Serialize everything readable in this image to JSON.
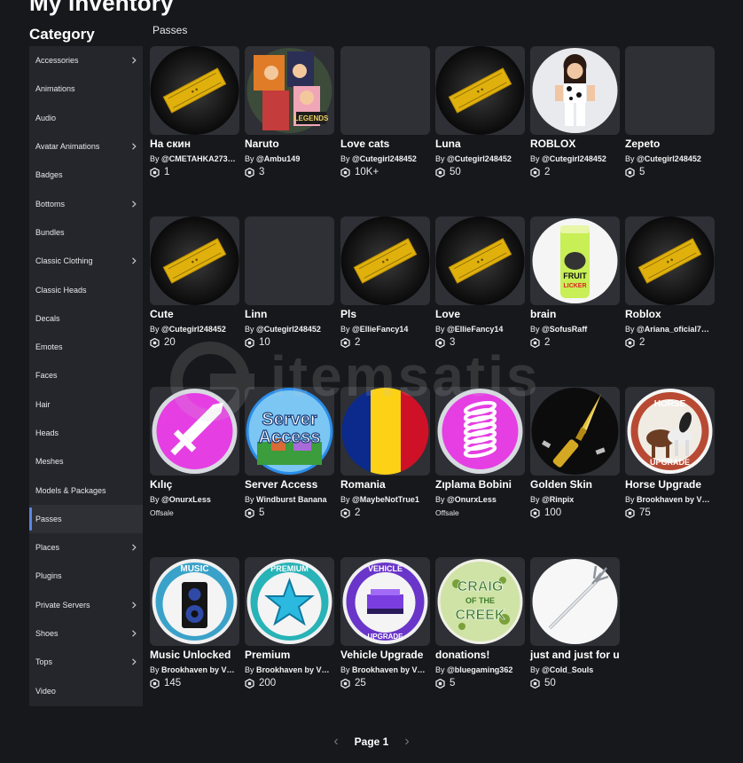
{
  "page": {
    "title": "My Inventory",
    "category_heading": "Category",
    "section_label": "Passes"
  },
  "sidebar": {
    "items": [
      {
        "label": "Accessories",
        "chevron": true
      },
      {
        "label": "Animations",
        "chevron": false
      },
      {
        "label": "Audio",
        "chevron": false
      },
      {
        "label": "Avatar Animations",
        "chevron": true
      },
      {
        "label": "Badges",
        "chevron": false
      },
      {
        "label": "Bottoms",
        "chevron": true
      },
      {
        "label": "Bundles",
        "chevron": false
      },
      {
        "label": "Classic Clothing",
        "chevron": true
      },
      {
        "label": "Classic Heads",
        "chevron": false
      },
      {
        "label": "Decals",
        "chevron": false
      },
      {
        "label": "Emotes",
        "chevron": false
      },
      {
        "label": "Faces",
        "chevron": false
      },
      {
        "label": "Hair",
        "chevron": false
      },
      {
        "label": "Heads",
        "chevron": false
      },
      {
        "label": "Meshes",
        "chevron": false
      },
      {
        "label": "Models & Packages",
        "chevron": false
      },
      {
        "label": "Passes",
        "chevron": false,
        "active": true
      },
      {
        "label": "Places",
        "chevron": true
      },
      {
        "label": "Plugins",
        "chevron": false
      },
      {
        "label": "Private Servers",
        "chevron": true
      },
      {
        "label": "Shoes",
        "chevron": true
      },
      {
        "label": "Tops",
        "chevron": true
      },
      {
        "label": "Video",
        "chevron": false
      }
    ]
  },
  "items": [
    {
      "name": "На скин",
      "by": "By",
      "creator": "@CMETAHKA273…",
      "price": "1",
      "thumb": "ticket"
    },
    {
      "name": "Naruto",
      "by": "By",
      "creator": "@Ambu149",
      "price": "3",
      "thumb": "naruto"
    },
    {
      "name": "Love cats",
      "by": "By",
      "creator": "@Cutegirl248452",
      "price": "10K+",
      "thumb": "blank"
    },
    {
      "name": "Luna",
      "by": "By",
      "creator": "@Cutegirl248452",
      "price": "50",
      "thumb": "ticket"
    },
    {
      "name": "ROBLOX",
      "by": "By",
      "creator": "@Cutegirl248452",
      "price": "2",
      "thumb": "avatar"
    },
    {
      "name": "Zepeto",
      "by": "By",
      "creator": "@Cutegirl248452",
      "price": "5",
      "thumb": "blank"
    },
    {
      "name": "Cute",
      "by": "By",
      "creator": "@Cutegirl248452",
      "price": "20",
      "thumb": "ticket"
    },
    {
      "name": "Linn",
      "by": "By",
      "creator": "@Cutegirl248452",
      "price": "10",
      "thumb": "blank"
    },
    {
      "name": "Pls",
      "by": "By",
      "creator": "@EllieFancy14",
      "price": "2",
      "thumb": "ticket"
    },
    {
      "name": "Love",
      "by": "By",
      "creator": "@EllieFancy14",
      "price": "3",
      "thumb": "ticket"
    },
    {
      "name": "brain",
      "by": "By",
      "creator": "@SofusRaff",
      "price": "2",
      "thumb": "can"
    },
    {
      "name": "Roblox",
      "by": "By",
      "creator": "@Ariana_oficial7…",
      "price": "2",
      "thumb": "ticket"
    },
    {
      "name": "Kılıç",
      "by": "By",
      "creator": "@OnurxLess",
      "price": "",
      "offsale": "Offsale",
      "thumb": "sword"
    },
    {
      "name": "Server Access",
      "by": "By",
      "creator": "Windburst Banana",
      "price": "5",
      "thumb": "server"
    },
    {
      "name": "Romania",
      "by": "By",
      "creator": "@MaybeNotTrue1",
      "price": "2",
      "thumb": "flag"
    },
    {
      "name": "Zıplama Bobini",
      "by": "By",
      "creator": "@OnurxLess",
      "price": "",
      "offsale": "Offsale",
      "thumb": "spring"
    },
    {
      "name": "Golden Skin",
      "by": "By",
      "creator": "@Rinpix",
      "price": "100",
      "thumb": "knife"
    },
    {
      "name": "Horse Upgrade",
      "by": "By",
      "creator": "Brookhaven by V…",
      "price": "75",
      "thumb": "horse"
    },
    {
      "name": "Music Unlocked",
      "by": "By",
      "creator": "Brookhaven by V…",
      "price": "145",
      "thumb": "music",
      "badge_text": "MUSIC"
    },
    {
      "name": "Premium",
      "by": "By",
      "creator": "Brookhaven by V…",
      "price": "200",
      "thumb": "premium",
      "badge_text": "PREMIUM"
    },
    {
      "name": "Vehicle Upgrade",
      "by": "By",
      "creator": "Brookhaven by V…",
      "price": "25",
      "thumb": "vehicle",
      "badge_text": "VEHICLE",
      "badge_text2": "UPGRADE"
    },
    {
      "name": "donations!",
      "by": "By",
      "creator": "@bluegaming362",
      "price": "5",
      "thumb": "craig"
    },
    {
      "name": "just and just for u",
      "by": "By",
      "creator": "@Cold_Souls",
      "price": "50",
      "thumb": "staff"
    }
  ],
  "thumb_texts": {
    "server": [
      "Server",
      "Access"
    ],
    "horse": [
      "HORSE",
      "UPGRADE"
    ],
    "craig": [
      "CRAIG",
      "OF THE",
      "CREEK"
    ],
    "can": [
      "FRUIT",
      "LICKER"
    ]
  },
  "pagination": {
    "label": "Page 1"
  },
  "watermark": {
    "text": "itemsatis"
  },
  "colors": {
    "background": "#17181b",
    "sidebar": "#24262c",
    "card": "#2e3036",
    "active_accent": "#5b86e5",
    "ticket_gold": "#e0b10d"
  }
}
